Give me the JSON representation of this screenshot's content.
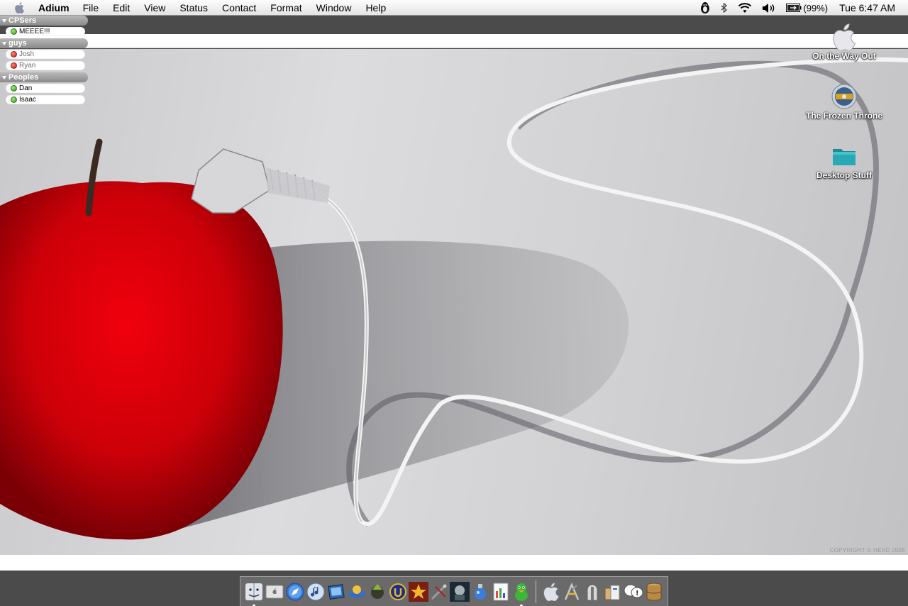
{
  "menubar": {
    "app_name": "Adium",
    "items": [
      "File",
      "Edit",
      "View",
      "Status",
      "Contact",
      "Format",
      "Window",
      "Help"
    ],
    "battery": "(99%)",
    "clock": "Tue 6:47 AM"
  },
  "contact_list": {
    "groups": [
      {
        "name": "CPSers",
        "contacts": [
          {
            "name": "MEEEE!!!",
            "status": "available"
          }
        ]
      },
      {
        "name": "guys",
        "contacts": [
          {
            "name": "Josh",
            "status": "away"
          },
          {
            "name": "Ryan",
            "status": "away"
          }
        ]
      },
      {
        "name": "Peoples",
        "contacts": [
          {
            "name": "Dan",
            "status": "available"
          },
          {
            "name": "Isaac",
            "status": "available"
          }
        ]
      }
    ]
  },
  "desktop_icons": [
    {
      "label": "On the Way Out",
      "icon": "apple-disk-icon"
    },
    {
      "label": "The Frozen Throne",
      "icon": "warcraft-cd-icon"
    },
    {
      "label": "Desktop Stuff",
      "icon": "teal-folder-icon"
    }
  ],
  "wallpaper": {
    "copyright": "COPYRIGHT © HEAD 2005"
  },
  "colors": {
    "apple_red": "#d0000a",
    "available": "#2f9a14",
    "away": "#c0160a"
  }
}
